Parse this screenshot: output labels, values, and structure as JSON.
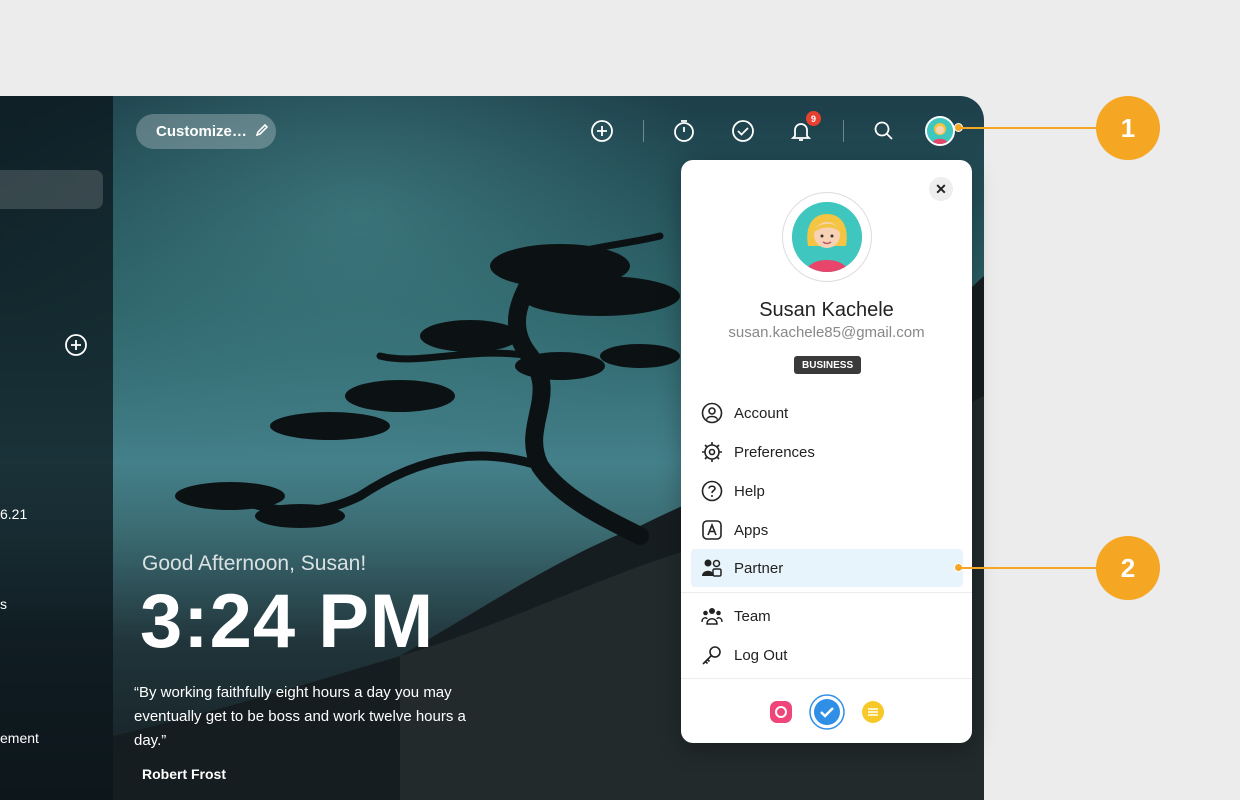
{
  "topbar": {
    "customize_label": "Customize…",
    "icons": [
      "add-icon",
      "timer-icon",
      "check-circle-icon",
      "bell-icon",
      "search-icon"
    ],
    "notification_count": "9"
  },
  "sidebar": {
    "fragments": [
      "6.21",
      "s",
      "ement"
    ]
  },
  "main": {
    "greeting": "Good Afternoon, Susan!",
    "time": "3:24 PM",
    "quote": "“By working faithfully eight hours a day you may eventually get to be boss and work twelve hours a day.”",
    "author": "Robert Frost"
  },
  "profile_menu": {
    "name": "Susan Kachele",
    "email": "susan.kachele85@gmail.com",
    "plan": "BUSINESS",
    "items": [
      {
        "label": "Account",
        "icon": "account-icon"
      },
      {
        "label": "Preferences",
        "icon": "gear-icon"
      },
      {
        "label": "Help",
        "icon": "help-icon"
      },
      {
        "label": "Apps",
        "icon": "apps-icon"
      },
      {
        "label": "Partner",
        "icon": "partner-icon",
        "active": true
      },
      {
        "label": "Team",
        "icon": "team-icon"
      },
      {
        "label": "Log Out",
        "icon": "key-icon"
      }
    ],
    "app_icons": [
      {
        "name": "focus-app-icon",
        "color": "#f0457a"
      },
      {
        "name": "todo-app-icon",
        "color": "#2f8fe6"
      },
      {
        "name": "notes-app-icon",
        "color": "#f7c928"
      }
    ]
  },
  "callouts": [
    "1",
    "2"
  ],
  "colors": {
    "accent": "#f5a623",
    "badge": "#e8402f",
    "active_row": "#e8f4fb"
  }
}
